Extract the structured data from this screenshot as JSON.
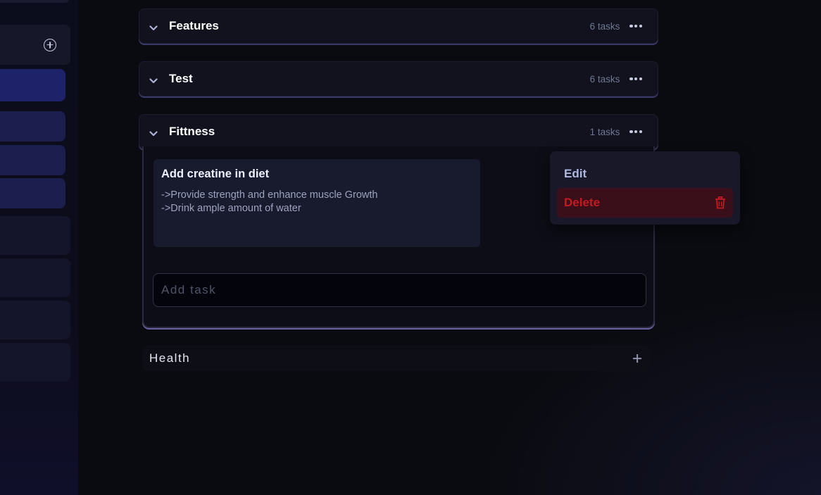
{
  "sidebar": {
    "add_icon": "plus-circle-icon"
  },
  "groups": [
    {
      "title": "Features",
      "count": "6 tasks",
      "chevron_icon": "chevron-down-icon",
      "menu_icon": "more-dots-icon"
    },
    {
      "title": "Test",
      "count": "6 tasks",
      "chevron_icon": "chevron-down-icon",
      "menu_icon": "more-dots-icon"
    },
    {
      "title": "Fittness",
      "count": "1 tasks",
      "chevron_icon": "chevron-down-icon",
      "menu_icon": "more-dots-icon"
    }
  ],
  "expanded_group": {
    "tasks": [
      {
        "title": "Add creatine in diet",
        "description_lines": [
          "->Provide strength and enhance muscle Growth",
          "->Drink ample amount of water"
        ]
      }
    ],
    "add_task_placeholder": "Add task"
  },
  "context_menu": {
    "edit_label": "Edit",
    "delete_label": "Delete",
    "delete_icon": "trash-icon",
    "delete_color": "#c41a22"
  },
  "new_group": {
    "label": "Health",
    "add_icon": "plus-icon"
  },
  "colors": {
    "background": "#0a0b10",
    "sidebar_active": "#1e2268",
    "card": "#181a2e",
    "accent_border": "#6a5fa0"
  }
}
